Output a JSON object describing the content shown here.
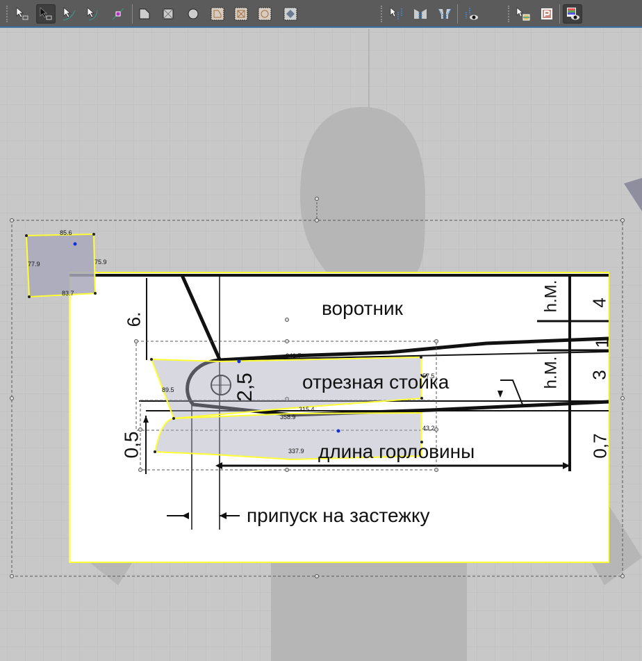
{
  "toolbar": {
    "groups": [
      {
        "tools": [
          {
            "icon": "transform-pattern-icon",
            "active": false
          },
          {
            "icon": "edit-pattern-icon",
            "active": true
          },
          {
            "icon": "edit-curvature-icon",
            "active": false
          },
          {
            "icon": "edit-curve-point-icon",
            "active": false
          },
          {
            "icon": "add-point-icon",
            "active": false
          }
        ]
      },
      {
        "tools": [
          {
            "icon": "polygon-icon"
          },
          {
            "icon": "rectangle-icon"
          },
          {
            "icon": "circle-icon"
          },
          {
            "icon": "internal-polygon-icon"
          },
          {
            "icon": "internal-rectangle-icon"
          },
          {
            "icon": "internal-circle-icon"
          },
          {
            "icon": "dart-icon"
          }
        ]
      },
      {
        "tools": [
          {
            "icon": "edit-sewing-icon"
          },
          {
            "icon": "segment-sewing-icon"
          },
          {
            "icon": "free-sewing-icon"
          },
          {
            "icon": "show-sewing-icon"
          }
        ]
      },
      {
        "tools": [
          {
            "icon": "select-texture-icon"
          },
          {
            "icon": "pattern-p-icon"
          },
          {
            "icon": "show-texture-icon",
            "active": true
          }
        ]
      }
    ]
  },
  "reference_image": {
    "labels": {
      "collar": "воротник",
      "stand": "отрезная стойка",
      "neck_length": "длина горловины",
      "allowance": "припуск на застежку",
      "dim_6": "6.",
      "dim_25": "2,5",
      "dim_05": "0,5",
      "dim_4": "4",
      "dim_1": "1",
      "dim_3": "3",
      "dim_07": "0,7",
      "hm_top": "h.M.",
      "hm_mid": "h.M."
    }
  },
  "patterns": {
    "small_square": {
      "top": "85.6",
      "left": "77.9",
      "right": "75.9",
      "bottom": "83.7"
    },
    "collar_stand": {
      "top": "341.7",
      "right": "57.5",
      "left": "89.5",
      "bottom": "315.4"
    },
    "neckband": {
      "top": "358.9",
      "right": "43.2",
      "bottom": "337.9"
    }
  },
  "colors": {
    "selection": "#ffff33",
    "pattern_fill": "#a8a8bc",
    "toolbar": "#5b5b5b"
  }
}
